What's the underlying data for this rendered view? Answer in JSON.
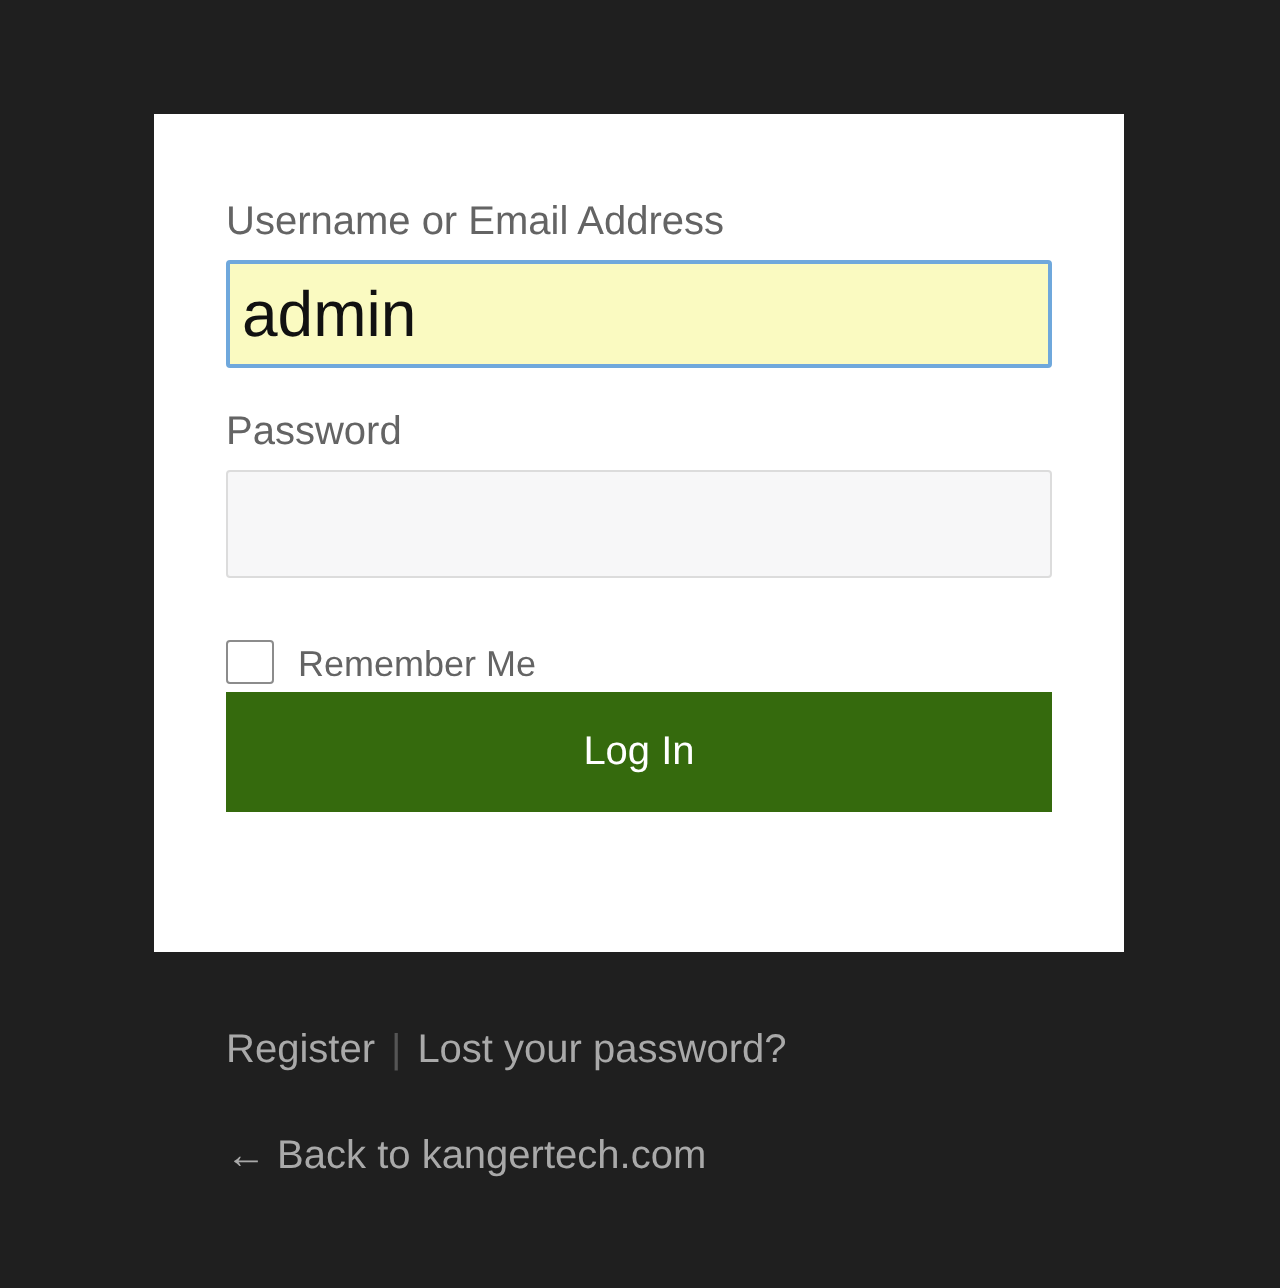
{
  "login_form": {
    "username": {
      "label": "Username or Email Address",
      "value": "admin",
      "autofilled": true
    },
    "password": {
      "label": "Password"
    },
    "remember_me": {
      "label": "Remember Me",
      "checked": false
    },
    "submit": {
      "label": "Log In"
    }
  },
  "nav_links": [
    {
      "label": "Register"
    },
    {
      "label": "Lost your password?"
    }
  ],
  "separator": "|",
  "back_link": {
    "label": "← Back to kangertech.com"
  }
}
